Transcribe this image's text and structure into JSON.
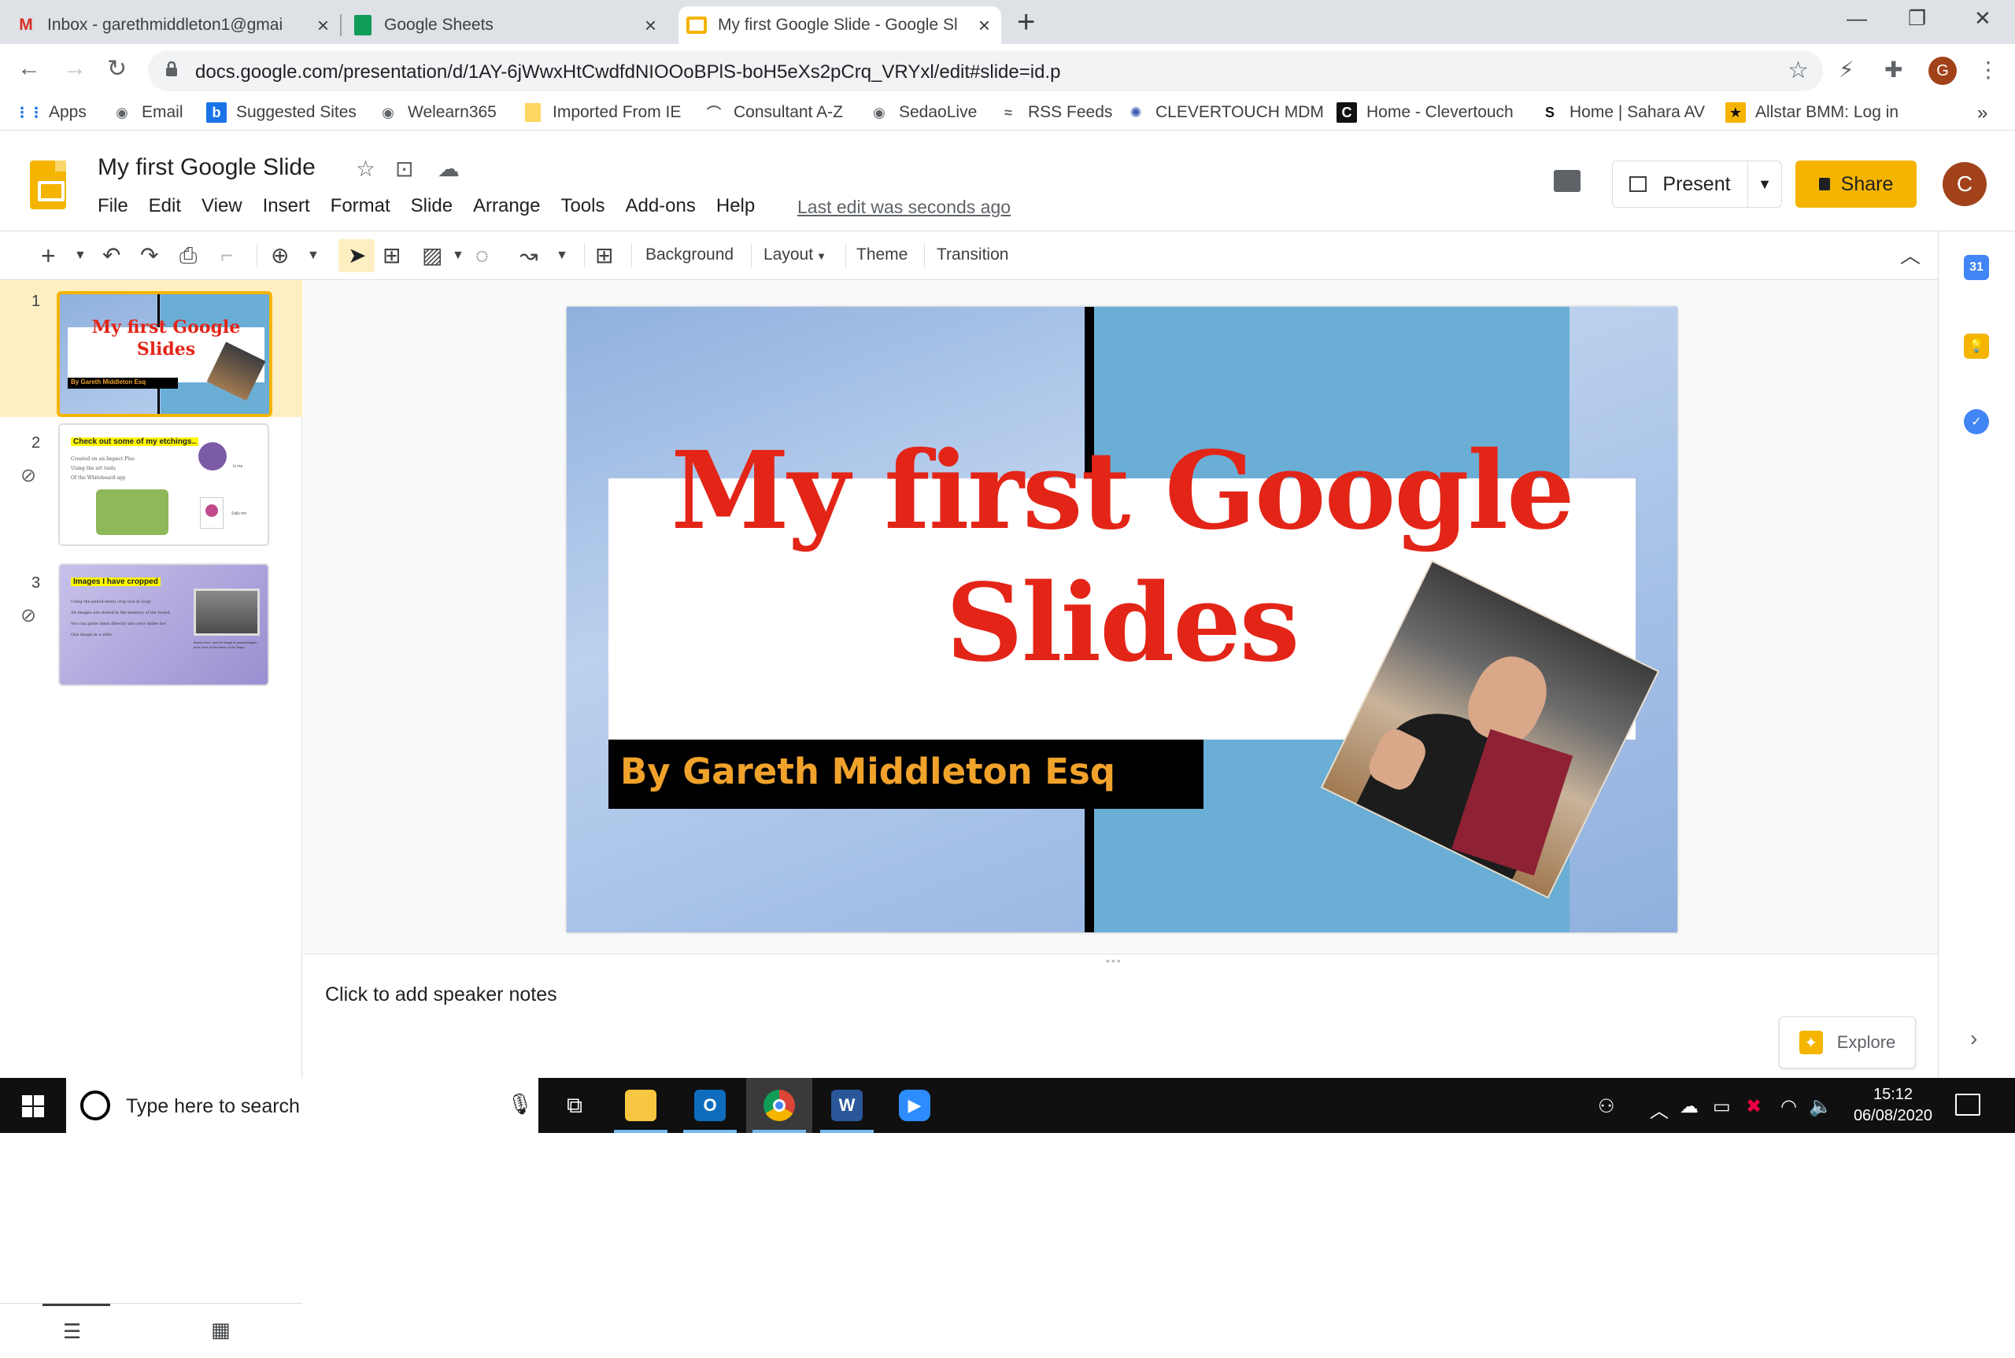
{
  "browser": {
    "tabs": [
      {
        "title": "Inbox - garethmiddleton1@gmai",
        "favicon": "gmail-icon",
        "color": "#d93025"
      },
      {
        "title": "Google Sheets",
        "favicon": "sheets-icon",
        "color": "#0f9d58"
      },
      {
        "title": "My first Google Slide - Google Sl",
        "favicon": "slides-icon",
        "color": "#f4b400",
        "active": true
      }
    ],
    "url": "docs.google.com/presentation/d/1AY-6jWwxHtCwdfdNIOOoBPlS-boH5eXs2pCrq_VRYxl/edit#slide=id.p",
    "profile_initial": "G",
    "bookmarks": [
      "Apps",
      "Email",
      "Suggested Sites",
      "Welearn365",
      "Imported From IE",
      "Consultant A-Z",
      "SedaoLive",
      "RSS Feeds",
      "CLEVERTOUCH MDM",
      "Home - Clevertouch",
      "Home | Sahara AV",
      "Allstar BMM: Log in"
    ],
    "more_bookmarks": "»"
  },
  "doc": {
    "title": "My first Google Slide",
    "menu": [
      "File",
      "Edit",
      "View",
      "Insert",
      "Format",
      "Slide",
      "Arrange",
      "Tools",
      "Add-ons",
      "Help"
    ],
    "last_edit": "Last edit was seconds ago",
    "present_label": "Present",
    "share_label": "Share",
    "user_initial": "C"
  },
  "toolbar": {
    "background": "Background",
    "layout": "Layout",
    "theme": "Theme",
    "transition": "Transition"
  },
  "slides": [
    {
      "number": "1",
      "title": "My first Google Slides",
      "subtitle": "By Gareth Middleton Esq"
    },
    {
      "number": "2",
      "heading": "Check out some of my etchings..",
      "lines": [
        "Created on an Impact Plus",
        "Using the art tools",
        "Of the Whiteboard app"
      ],
      "caption1": "Is me",
      "caption2": "Sally me"
    },
    {
      "number": "3",
      "heading": "Images I have cropped",
      "lines": [
        "Using the pencil menu crop tool in Gogl",
        "All Images are stored in the memory of the board.",
        "You can paste them directly into your slides doc",
        "One image in a slide."
      ],
      "caption": "Barber lived, and the image of archaeologists finds more in the history of the Mage"
    }
  ],
  "current_slide": {
    "title_line1": "My first Google",
    "title_line2": "Slides",
    "subtitle": "By Gareth Middleton Esq"
  },
  "notes_placeholder": "Click to add speaker notes",
  "explore_label": "Explore",
  "taskbar": {
    "search_placeholder": "Type here to search",
    "time": "15:12",
    "date": "06/08/2020"
  }
}
